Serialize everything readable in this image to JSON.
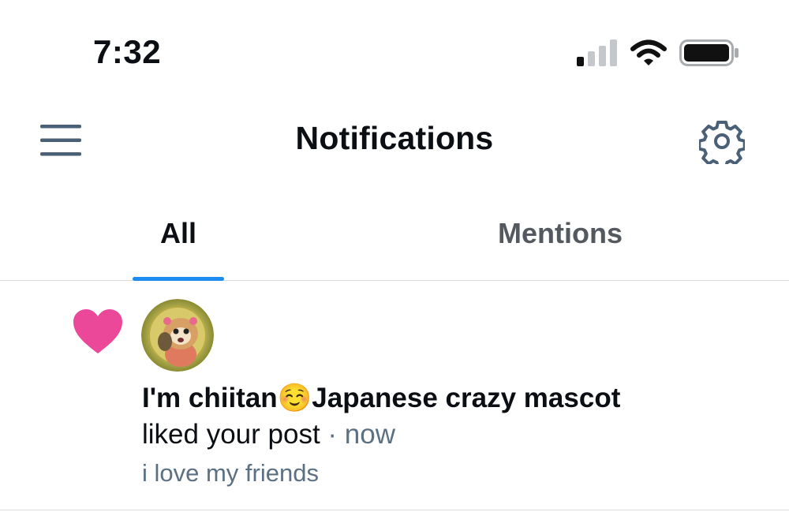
{
  "status_bar": {
    "time": "7:32"
  },
  "header": {
    "title": "Notifications"
  },
  "tabs": [
    {
      "label": "All",
      "active": true
    },
    {
      "label": "Mentions",
      "active": false
    }
  ],
  "colors": {
    "accent": "#1d8cf0",
    "heart": "#ec4899",
    "muted": "#5b7083",
    "icon": "#4a6076"
  },
  "icons": [
    "hamburger-menu-icon",
    "gear-icon",
    "heart-icon",
    "signal-icon",
    "wifi-icon",
    "battery-icon"
  ],
  "notifications": [
    {
      "type": "like",
      "author_name": "I'm chiitan",
      "author_emoji": "☺️",
      "author_suffix": "Japanese crazy mascot",
      "action": "liked your post",
      "separator": " · ",
      "time": "now",
      "post_text": "i love my friends"
    }
  ]
}
